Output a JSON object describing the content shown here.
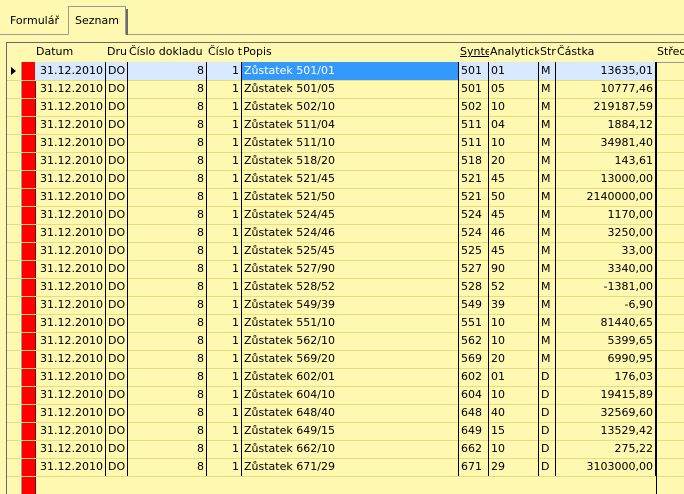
{
  "tabs": [
    {
      "label": "Formulář",
      "active": false
    },
    {
      "label": "Seznam",
      "active": true
    }
  ],
  "columns": {
    "datum": "Datum",
    "druh": "Druh",
    "cislo_dokladu": "Číslo dokladu",
    "cislo_t": "Číslo t",
    "popis": "Popis",
    "synte": "Synte",
    "analyticka": "Analytická",
    "str": "Str",
    "castka": "Částka",
    "stredisko": "Středi"
  },
  "rows": [
    {
      "datum": "31.12.2010",
      "druh": "DO",
      "doklad": "8",
      "t": "1",
      "popis": "Zůstatek 501/01",
      "synte": "501",
      "anal": "01",
      "str": "M",
      "castka": "13635,01"
    },
    {
      "datum": "31.12.2010",
      "druh": "DO",
      "doklad": "8",
      "t": "1",
      "popis": "Zůstatek 501/05",
      "synte": "501",
      "anal": "05",
      "str": "M",
      "castka": "10777,46"
    },
    {
      "datum": "31.12.2010",
      "druh": "DO",
      "doklad": "8",
      "t": "1",
      "popis": "Zůstatek 502/10",
      "synte": "502",
      "anal": "10",
      "str": "M",
      "castka": "219187,59"
    },
    {
      "datum": "31.12.2010",
      "druh": "DO",
      "doklad": "8",
      "t": "1",
      "popis": "Zůstatek 511/04",
      "synte": "511",
      "anal": "04",
      "str": "M",
      "castka": "1884,12"
    },
    {
      "datum": "31.12.2010",
      "druh": "DO",
      "doklad": "8",
      "t": "1",
      "popis": "Zůstatek 511/10",
      "synte": "511",
      "anal": "10",
      "str": "M",
      "castka": "34981,40"
    },
    {
      "datum": "31.12.2010",
      "druh": "DO",
      "doklad": "8",
      "t": "1",
      "popis": "Zůstatek 518/20",
      "synte": "518",
      "anal": "20",
      "str": "M",
      "castka": "143,61"
    },
    {
      "datum": "31.12.2010",
      "druh": "DO",
      "doklad": "8",
      "t": "1",
      "popis": "Zůstatek 521/45",
      "synte": "521",
      "anal": "45",
      "str": "M",
      "castka": "13000,00"
    },
    {
      "datum": "31.12.2010",
      "druh": "DO",
      "doklad": "8",
      "t": "1",
      "popis": "Zůstatek 521/50",
      "synte": "521",
      "anal": "50",
      "str": "M",
      "castka": "2140000,00"
    },
    {
      "datum": "31.12.2010",
      "druh": "DO",
      "doklad": "8",
      "t": "1",
      "popis": "Zůstatek 524/45",
      "synte": "524",
      "anal": "45",
      "str": "M",
      "castka": "1170,00"
    },
    {
      "datum": "31.12.2010",
      "druh": "DO",
      "doklad": "8",
      "t": "1",
      "popis": "Zůstatek 524/46",
      "synte": "524",
      "anal": "46",
      "str": "M",
      "castka": "3250,00"
    },
    {
      "datum": "31.12.2010",
      "druh": "DO",
      "doklad": "8",
      "t": "1",
      "popis": "Zůstatek 525/45",
      "synte": "525",
      "anal": "45",
      "str": "M",
      "castka": "33,00"
    },
    {
      "datum": "31.12.2010",
      "druh": "DO",
      "doklad": "8",
      "t": "1",
      "popis": "Zůstatek 527/90",
      "synte": "527",
      "anal": "90",
      "str": "M",
      "castka": "3340,00"
    },
    {
      "datum": "31.12.2010",
      "druh": "DO",
      "doklad": "8",
      "t": "1",
      "popis": "Zůstatek 528/52",
      "synte": "528",
      "anal": "52",
      "str": "M",
      "castka": "-1381,00"
    },
    {
      "datum": "31.12.2010",
      "druh": "DO",
      "doklad": "8",
      "t": "1",
      "popis": "Zůstatek 549/39",
      "synte": "549",
      "anal": "39",
      "str": "M",
      "castka": "-6,90"
    },
    {
      "datum": "31.12.2010",
      "druh": "DO",
      "doklad": "8",
      "t": "1",
      "popis": "Zůstatek 551/10",
      "synte": "551",
      "anal": "10",
      "str": "M",
      "castka": "81440,65"
    },
    {
      "datum": "31.12.2010",
      "druh": "DO",
      "doklad": "8",
      "t": "1",
      "popis": "Zůstatek 562/10",
      "synte": "562",
      "anal": "10",
      "str": "M",
      "castka": "5399,65"
    },
    {
      "datum": "31.12.2010",
      "druh": "DO",
      "doklad": "8",
      "t": "1",
      "popis": "Zůstatek 569/20",
      "synte": "569",
      "anal": "20",
      "str": "M",
      "castka": "6990,95"
    },
    {
      "datum": "31.12.2010",
      "druh": "DO",
      "doklad": "8",
      "t": "1",
      "popis": "Zůstatek 602/01",
      "synte": "602",
      "anal": "01",
      "str": "D",
      "castka": "176,03"
    },
    {
      "datum": "31.12.2010",
      "druh": "DO",
      "doklad": "8",
      "t": "1",
      "popis": "Zůstatek 604/10",
      "synte": "604",
      "anal": "10",
      "str": "D",
      "castka": "19415,89"
    },
    {
      "datum": "31.12.2010",
      "druh": "DO",
      "doklad": "8",
      "t": "1",
      "popis": "Zůstatek 648/40",
      "synte": "648",
      "anal": "40",
      "str": "D",
      "castka": "32569,60"
    },
    {
      "datum": "31.12.2010",
      "druh": "DO",
      "doklad": "8",
      "t": "1",
      "popis": "Zůstatek 649/15",
      "synte": "649",
      "anal": "15",
      "str": "D",
      "castka": "13529,42"
    },
    {
      "datum": "31.12.2010",
      "druh": "DO",
      "doklad": "8",
      "t": "1",
      "popis": "Zůstatek 662/10",
      "synte": "662",
      "anal": "10",
      "str": "D",
      "castka": "275,22"
    },
    {
      "datum": "31.12.2010",
      "druh": "DO",
      "doklad": "8",
      "t": "1",
      "popis": "Zůstatek 671/29",
      "synte": "671",
      "anal": "29",
      "str": "D",
      "castka": "3103000,00"
    }
  ],
  "selected_row": 0,
  "colors": {
    "background": "#fff8b0",
    "marker": "#ff0000",
    "selection": "#3399ff"
  }
}
